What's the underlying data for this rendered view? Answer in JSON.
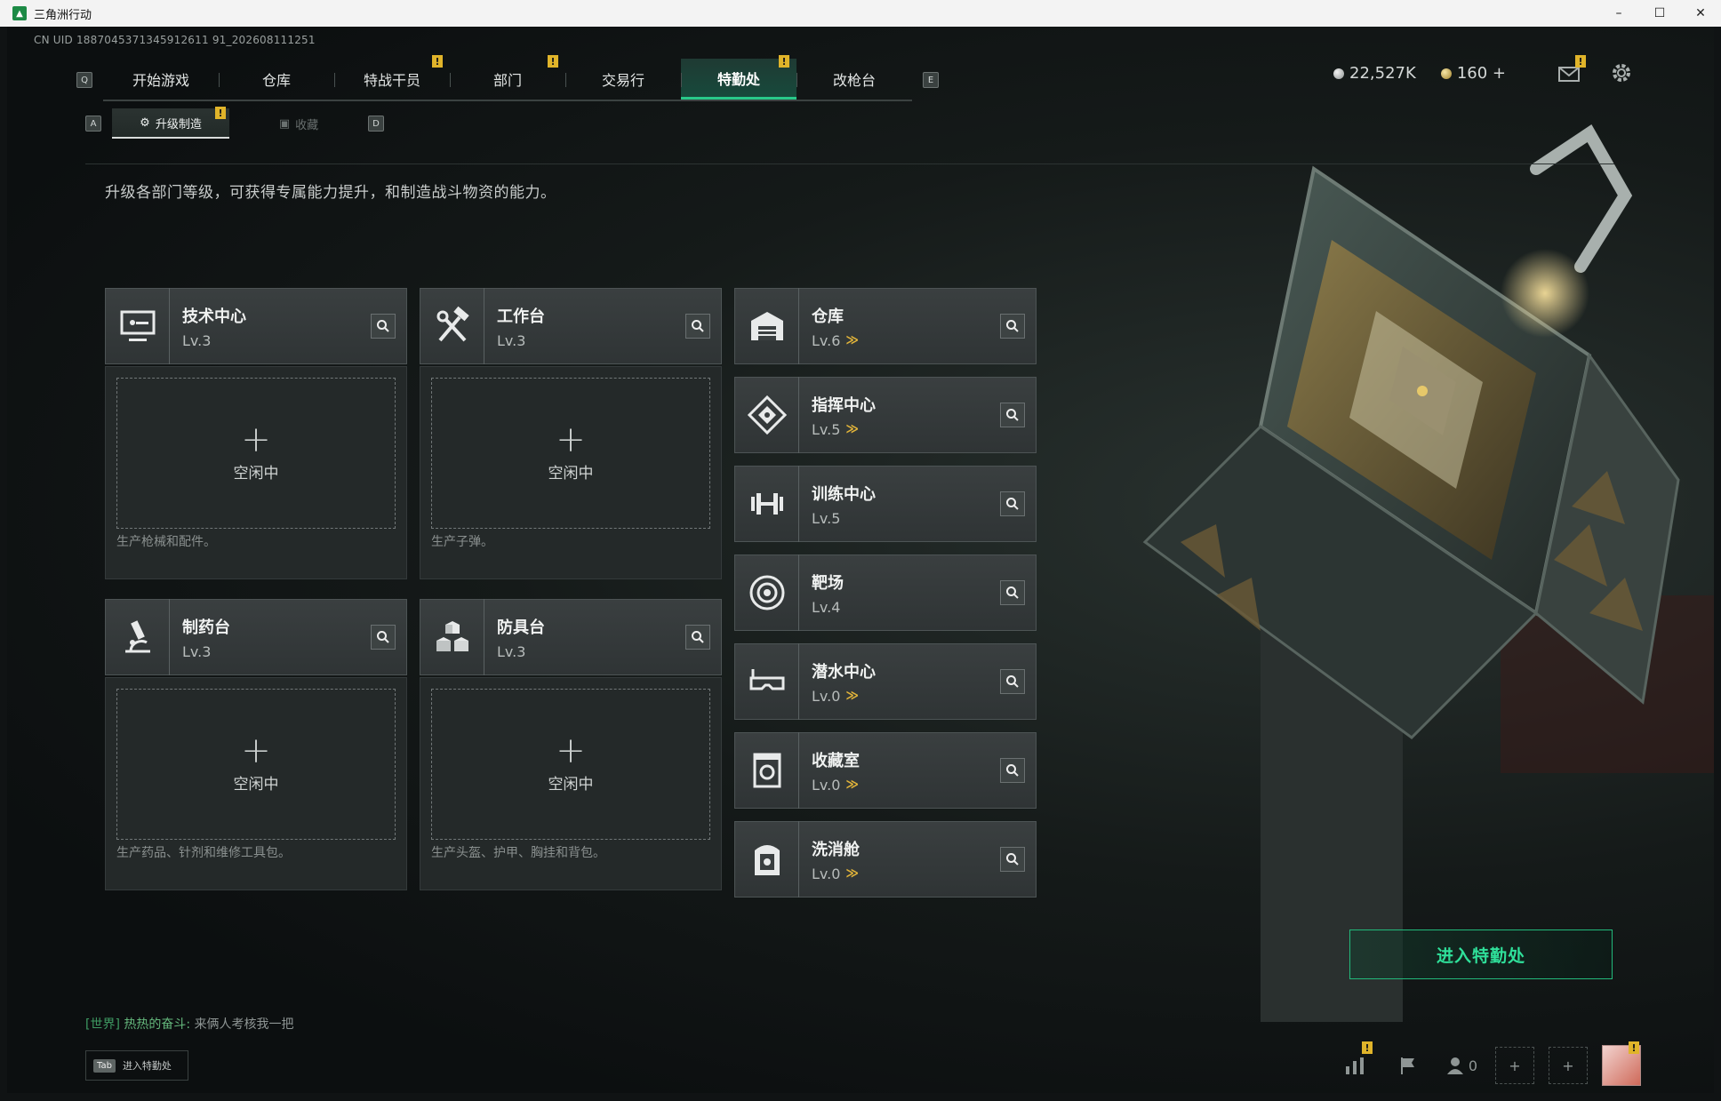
{
  "window": {
    "title": "三角洲行动",
    "minimize": "–",
    "maximize": "☐",
    "close": "✕"
  },
  "uid": "CN UID 1887045371345912611 91_202608111251",
  "nav": {
    "left_key": "Q",
    "right_key": "E",
    "tabs": [
      {
        "label": "开始游戏",
        "badge": ""
      },
      {
        "label": "仓库",
        "badge": ""
      },
      {
        "label": "特战干员",
        "badge": "!"
      },
      {
        "label": "部门",
        "badge": "!"
      },
      {
        "label": "交易行",
        "badge": ""
      },
      {
        "label": "特勤处",
        "badge": "!"
      },
      {
        "label": "改枪台",
        "badge": ""
      }
    ]
  },
  "currency": {
    "silver": "22,527K",
    "gold": "160",
    "add": "+"
  },
  "mail_badge": "!",
  "subtabs": {
    "left_key": "A",
    "right_key": "D",
    "items": [
      {
        "label": "升级制造",
        "badge": "!"
      },
      {
        "label": "收藏",
        "badge": ""
      }
    ]
  },
  "description": "升级各部门等级，可获得专属能力提升，和制造战斗物资的能力。",
  "production": [
    {
      "name": "技术中心",
      "level": "Lv.3",
      "status": "空闲中",
      "desc": "生产枪械和配件。",
      "icon": "monitor-icon"
    },
    {
      "name": "工作台",
      "level": "Lv.3",
      "status": "空闲中",
      "desc": "生产子弹。",
      "icon": "hammer-wrench-icon"
    },
    {
      "name": "制药台",
      "level": "Lv.3",
      "status": "空闲中",
      "desc": "生产药品、针剂和维修工具包。",
      "icon": "microscope-icon"
    },
    {
      "name": "防具台",
      "level": "Lv.3",
      "status": "空闲中",
      "desc": "生产头盔、护甲、胸挂和背包。",
      "icon": "cubes-icon"
    }
  ],
  "departments": [
    {
      "name": "仓库",
      "level": "Lv.6",
      "upgradable": true,
      "icon": "warehouse-icon"
    },
    {
      "name": "指挥中心",
      "level": "Lv.5",
      "upgradable": true,
      "icon": "chip-icon"
    },
    {
      "name": "训练中心",
      "level": "Lv.5",
      "upgradable": false,
      "icon": "dumbbell-icon"
    },
    {
      "name": "靶场",
      "level": "Lv.4",
      "upgradable": false,
      "icon": "target-icon"
    },
    {
      "name": "潜水中心",
      "level": "Lv.0",
      "upgradable": true,
      "icon": "diving-mask-icon"
    },
    {
      "name": "收藏室",
      "level": "Lv.0",
      "upgradable": true,
      "icon": "vault-icon"
    },
    {
      "name": "洗消舱",
      "level": "Lv.0",
      "upgradable": true,
      "icon": "decon-pod-icon"
    }
  ],
  "upgrade_mark": "≫",
  "enter_button": "进入特勤处",
  "chat": {
    "channel": "[世界]",
    "user": "热热的奋斗:",
    "message": "来俩人考核我一把"
  },
  "tab_hint": {
    "key": "Tab",
    "label": "进入特勤处"
  },
  "bottom": {
    "friends_count": "0",
    "add": "+"
  },
  "colors": {
    "accent": "#28c98a",
    "badge": "#e0b42a",
    "upgrade": "#e3b53a"
  }
}
